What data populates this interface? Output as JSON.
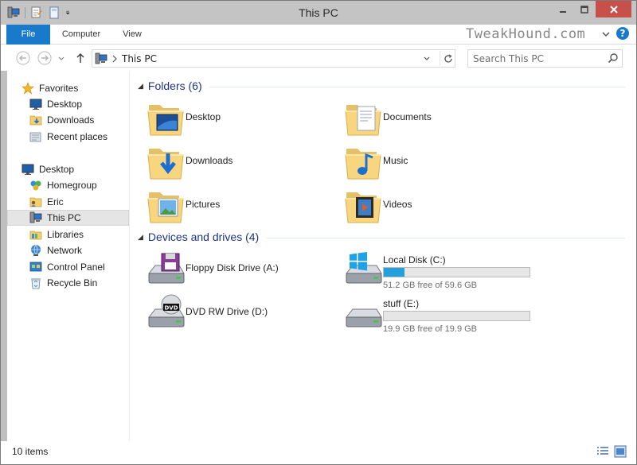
{
  "window": {
    "title": "This PC",
    "watermark": "TweakHound.com"
  },
  "ribbon": {
    "tabs": [
      {
        "label": "File"
      },
      {
        "label": "Computer"
      },
      {
        "label": "View"
      }
    ]
  },
  "address": {
    "path": "This PC"
  },
  "search": {
    "placeholder": "Search This PC"
  },
  "nav": {
    "favorites": {
      "label": "Favorites",
      "items": [
        {
          "label": "Desktop"
        },
        {
          "label": "Downloads"
        },
        {
          "label": "Recent places"
        }
      ]
    },
    "desktop": {
      "label": "Desktop",
      "items": [
        {
          "label": "Homegroup"
        },
        {
          "label": "Eric"
        },
        {
          "label": "This PC"
        },
        {
          "label": "Libraries"
        },
        {
          "label": "Network"
        },
        {
          "label": "Control Panel"
        },
        {
          "label": "Recycle Bin"
        }
      ]
    }
  },
  "content": {
    "folders_header": "Folders (6)",
    "folders": [
      {
        "name": "Desktop",
        "icon": "desktop-folder-icon"
      },
      {
        "name": "Documents",
        "icon": "documents-folder-icon"
      },
      {
        "name": "Downloads",
        "icon": "downloads-folder-icon"
      },
      {
        "name": "Music",
        "icon": "music-folder-icon"
      },
      {
        "name": "Pictures",
        "icon": "pictures-folder-icon"
      },
      {
        "name": "Videos",
        "icon": "videos-folder-icon"
      }
    ],
    "drives_header": "Devices and drives (4)",
    "drives": [
      {
        "name": "Floppy Disk Drive (A:)",
        "icon": "floppy-drive-icon"
      },
      {
        "name": "Local Disk (C:)",
        "icon": "windows-disk-icon",
        "free": "51.2 GB free of 59.6 GB",
        "used_fraction": 0.141
      },
      {
        "name": "DVD RW Drive (D:)",
        "icon": "dvd-drive-icon"
      },
      {
        "name": "stuff (E:)",
        "icon": "disk-icon",
        "free": "19.9 GB free of 19.9 GB",
        "used_fraction": 0.0
      }
    ]
  },
  "status": {
    "items": "10 items"
  },
  "colors": {
    "accent": "#1979ca",
    "close": "#c7504a",
    "group_header": "#1e3287",
    "bar_fill": "#26a0da"
  }
}
